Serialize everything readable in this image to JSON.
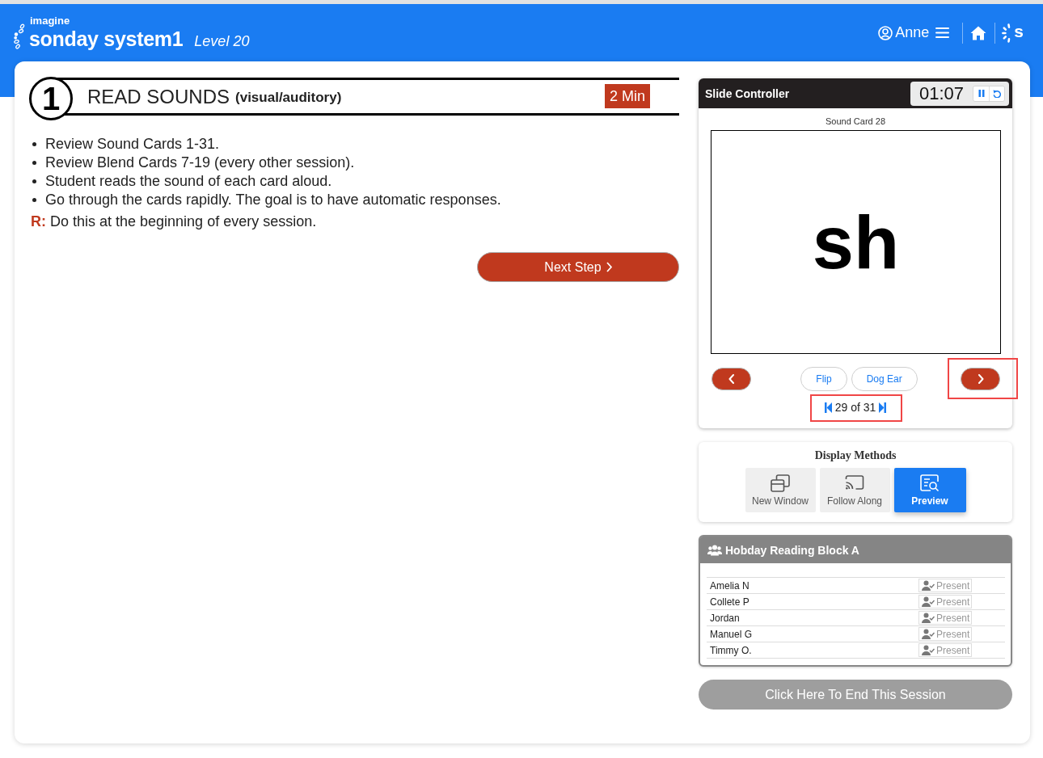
{
  "header": {
    "brand_tagline": "imagine",
    "brand_name": "sonday system1",
    "level": "Level 20",
    "user_name": "Anne",
    "app_logo_letter": "s"
  },
  "step": {
    "number": "1",
    "title": "READ SOUNDS",
    "subtitle": "(visual/auditory)",
    "duration": "2 Min",
    "instructions": [
      "Review Sound Cards 1-31.",
      "Review Blend Cards 7-19 (every other session).",
      "Student reads the sound of each card aloud.",
      "Go through the cards rapidly. The goal is to have automatic responses."
    ],
    "note": "**R:** Do this at the beginning of every session.",
    "next_button": "Next Step"
  },
  "slide_controller": {
    "title": "Slide Controller",
    "timer": "01:07",
    "card_label": "Sound Card 28",
    "card_text": "sh",
    "previous_button": {
      "highlighted": false
    },
    "actions": [
      "Flip",
      "Dog Ear"
    ],
    "next_button": {
      "highlighted": true
    },
    "page_counter": {
      "text": "29 of 31",
      "highlighted": true
    }
  },
  "display_methods": {
    "title": "Display Methods",
    "options": [
      {
        "label": "New Window",
        "kind": "window",
        "selected": false
      },
      {
        "label": "Follow Along",
        "kind": "cast",
        "selected": false
      },
      {
        "label": "Preview",
        "kind": "preview",
        "selected": true
      }
    ]
  },
  "roster": {
    "title": "Hobday Reading Block A",
    "students": [
      {
        "name": "Amelia N",
        "status": "Present"
      },
      {
        "name": "Collete P",
        "status": "Present"
      },
      {
        "name": "Jordan",
        "status": "Present"
      },
      {
        "name": "Manuel G",
        "status": "Present"
      },
      {
        "name": "Timmy O.",
        "status": "Present"
      }
    ]
  },
  "end_session_button": "Click Here To End This Session"
}
